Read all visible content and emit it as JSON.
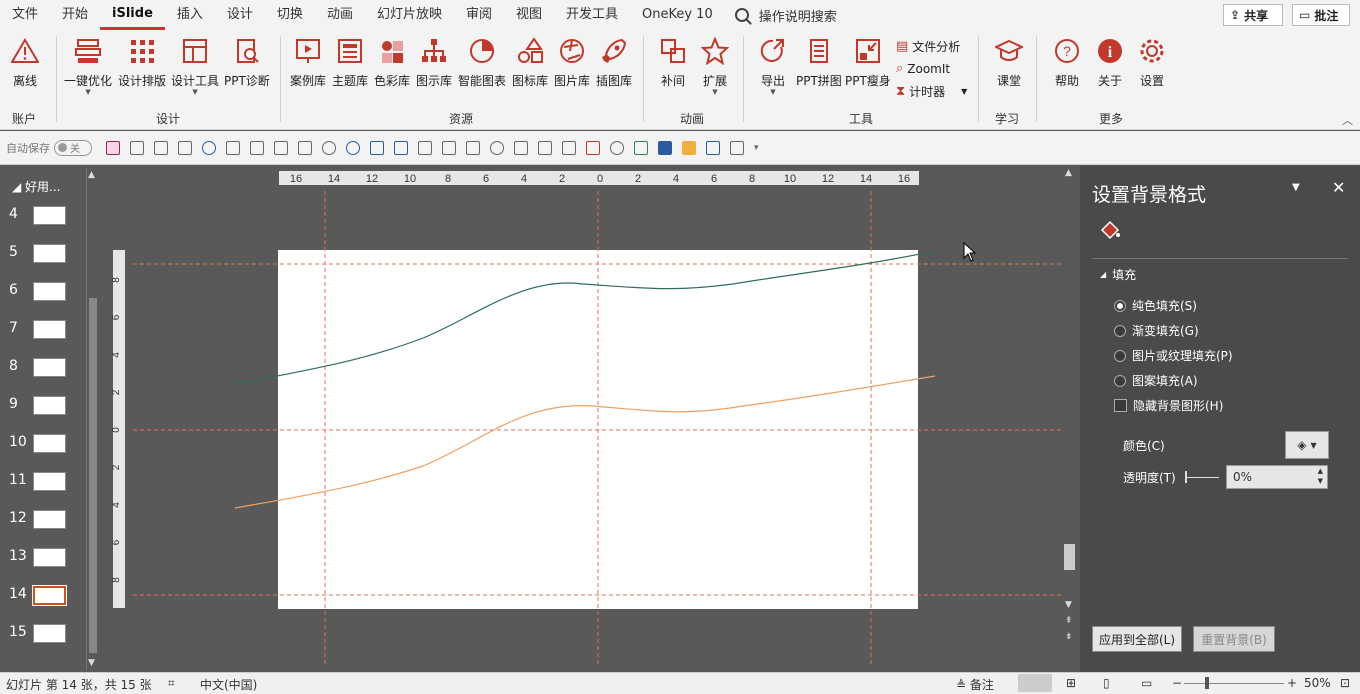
{
  "menu": {
    "items": [
      "文件",
      "开始",
      "iSlide",
      "插入",
      "设计",
      "切换",
      "动画",
      "幻灯片放映",
      "审阅",
      "视图",
      "开发工具",
      "OneKey 10"
    ],
    "active_index": 2,
    "search_label": "操作说明搜索",
    "share_label": "共享",
    "comment_label": "批注"
  },
  "ribbon": {
    "offline": "离线",
    "one_click": "一键优化",
    "design_layout": "设计排版",
    "design_tools": "设计工具",
    "ppt_diag": "PPT诊断",
    "case_lib": "案例库",
    "theme_lib": "主题库",
    "color_lib": "色彩库",
    "diagram_lib": "图示库",
    "smart_chart": "智能图表",
    "icon_lib": "图标库",
    "picture_lib": "图片库",
    "illus_lib": "插图库",
    "tween": "补间",
    "extend": "扩展",
    "export": "导出",
    "ppt_splice": "PPT拼图",
    "ppt_slim": "PPT瘦身",
    "file_analysis": "文件分析",
    "zoomit": "ZoomIt",
    "timer": "计时器",
    "classroom": "课堂",
    "help": "帮助",
    "about": "关于",
    "settings": "设置",
    "groups": {
      "account": "账户",
      "design": "设计",
      "resource": "资源",
      "animation": "动画",
      "tools": "工具",
      "learn": "学习",
      "more": "更多"
    }
  },
  "qat": {
    "autosave_label": "自动保存",
    "toggle_state": "关"
  },
  "thumbnails": {
    "section_label": "好用...",
    "numbers": [
      "4",
      "5",
      "6",
      "7",
      "8",
      "9",
      "10",
      "11",
      "12",
      "13",
      "14",
      "15"
    ],
    "selected": "14"
  },
  "ruler": {
    "h_ticks": [
      "16",
      "14",
      "12",
      "10",
      "8",
      "6",
      "4",
      "2",
      "0",
      "2",
      "4",
      "6",
      "8",
      "10",
      "12",
      "14",
      "16"
    ],
    "v_ticks": [
      "8",
      "6",
      "4",
      "2",
      "0",
      "2",
      "4",
      "6",
      "8"
    ]
  },
  "chart_data": {
    "type": "line",
    "series": [
      {
        "color": "#2e6e56"
      },
      {
        "color": "#f0a060"
      }
    ]
  },
  "format_pane": {
    "title": "设置背景格式",
    "section": "填充",
    "options": [
      "纯色填充(S)",
      "渐变填充(G)",
      "图片或纹理填充(P)",
      "图案填充(A)"
    ],
    "selected_option": 0,
    "hide_bg_label": "隐藏背景图形(H)",
    "color_label": "颜色(C)",
    "transparency_label": "透明度(T)",
    "transparency_value": "0%",
    "apply_all": "应用到全部(L)",
    "reset_bg": "重置背景(B)"
  },
  "status": {
    "slide_info": "幻灯片 第 14 张，共 15 张",
    "language": "中文(中国)",
    "notes": "备注",
    "zoom": "50%"
  },
  "colors": {
    "accent": "#c0392b",
    "pane_bg": "#4a4a4a",
    "canvas_bg": "#595959"
  }
}
